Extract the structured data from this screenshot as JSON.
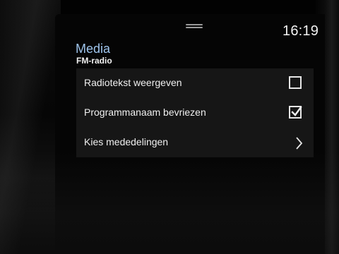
{
  "status_bar": {
    "time": "16:19",
    "handle_icon": "drag-handle-icon"
  },
  "header": {
    "title": "Media",
    "subtitle": "FM-radio"
  },
  "settings": [
    {
      "label": "Radiotekst weergeven",
      "control": "checkbox",
      "checked": false
    },
    {
      "label": "Programmanaam bevriezen",
      "control": "checkbox",
      "checked": true
    },
    {
      "label": "Kies mededelingen",
      "control": "chevron",
      "icon": "chevron-right-icon"
    }
  ],
  "colors": {
    "title": "#9ec4ec",
    "text": "#f0f0f0",
    "panel": "#161616"
  }
}
